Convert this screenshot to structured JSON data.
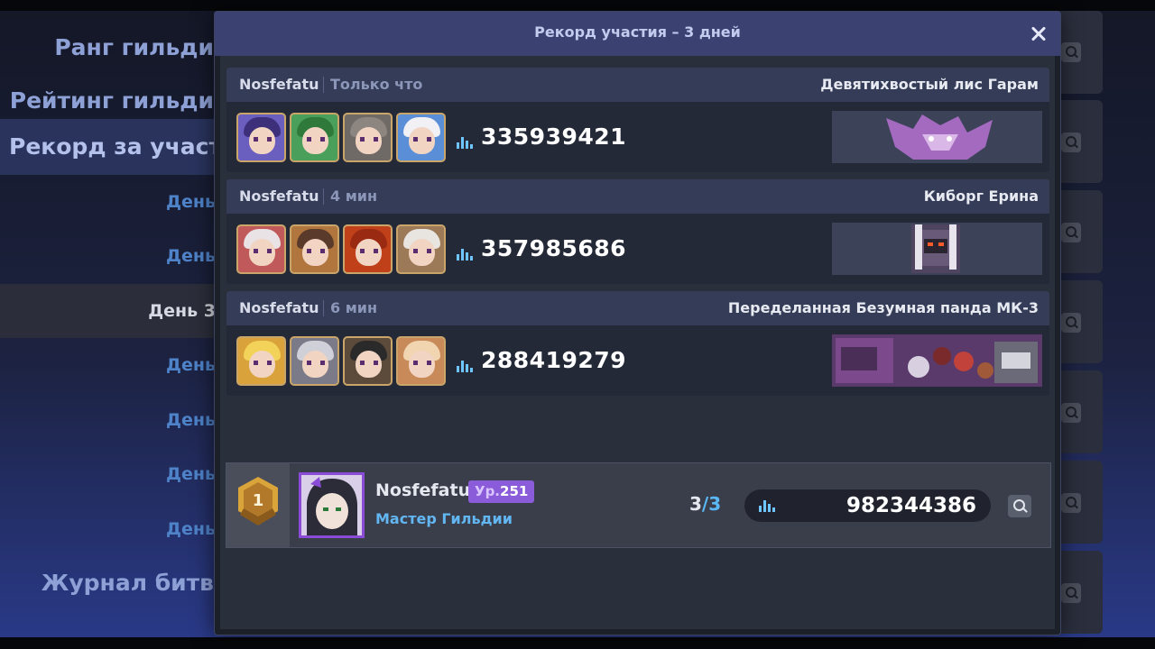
{
  "background": {
    "menu": [
      {
        "label": "Ранг гильди"
      },
      {
        "label": "Рейтинг гильди"
      },
      {
        "label": "Рекорд за участи"
      },
      {
        "label": "Журнал битв"
      }
    ],
    "days": [
      "День",
      "День",
      "День 3",
      "День",
      "День",
      "День",
      "День"
    ],
    "selected_day_index": 2
  },
  "modal": {
    "title": "Рекорд участия – 3 дней",
    "close_icon": "close-icon"
  },
  "records": [
    {
      "player": "Nosfefatu",
      "time": "Только что",
      "boss": "Девятихвостый лис Гарам",
      "score": "335939421",
      "heroes": [
        {
          "bg": "#6a5fbf",
          "hair": "#3d2f7a"
        },
        {
          "bg": "#4aa05a",
          "hair": "#2f7a3b"
        },
        {
          "bg": "#6f6a66",
          "hair": "#8c8580"
        },
        {
          "bg": "#5a8fd8",
          "hair": "#f0f0f5"
        }
      ],
      "boss_colors": {
        "bg": "#3c4257",
        "main": "#a36ac0"
      }
    },
    {
      "player": "Nosfefatu",
      "time": "4 мин",
      "boss": "Киборг Ерина",
      "score": "357985686",
      "heroes": [
        {
          "bg": "#c05a5a",
          "hair": "#e9e3e6"
        },
        {
          "bg": "#b0763e",
          "hair": "#5a3a2a"
        },
        {
          "bg": "#c0401a",
          "hair": "#9a2a12"
        },
        {
          "bg": "#9c7a58",
          "hair": "#e8e4e0"
        }
      ],
      "boss_colors": {
        "bg": "#3c4257",
        "main": "#6a5a7a"
      }
    },
    {
      "player": "Nosfefatu",
      "time": "6 мин",
      "boss": "Переделанная Безумная панда МК-3",
      "score": "288419279",
      "heroes": [
        {
          "bg": "#d9a23a",
          "hair": "#f3d25a"
        },
        {
          "bg": "#7a7a88",
          "hair": "#d0d0d8"
        },
        {
          "bg": "#5c4a3a",
          "hair": "#2a2a2a"
        },
        {
          "bg": "#c98a5a",
          "hair": "#f0d5b0"
        }
      ],
      "boss_colors": {
        "bg": "#5a3a6a",
        "main": "#7c4a8c"
      }
    }
  ],
  "leader": {
    "rank": "1",
    "name": "Nosfefatu",
    "level_prefix": "Ур.",
    "level": "251",
    "role": "Мастер Гильдии",
    "count_done": "3",
    "count_slash": "/",
    "count_total": "3",
    "total_score": "982344386"
  },
  "colors": {
    "accent_blue": "#5ab8f5",
    "level_purple": "#8b5cd9",
    "header": "#3b4272",
    "medal_gold": "#d9a53a"
  }
}
